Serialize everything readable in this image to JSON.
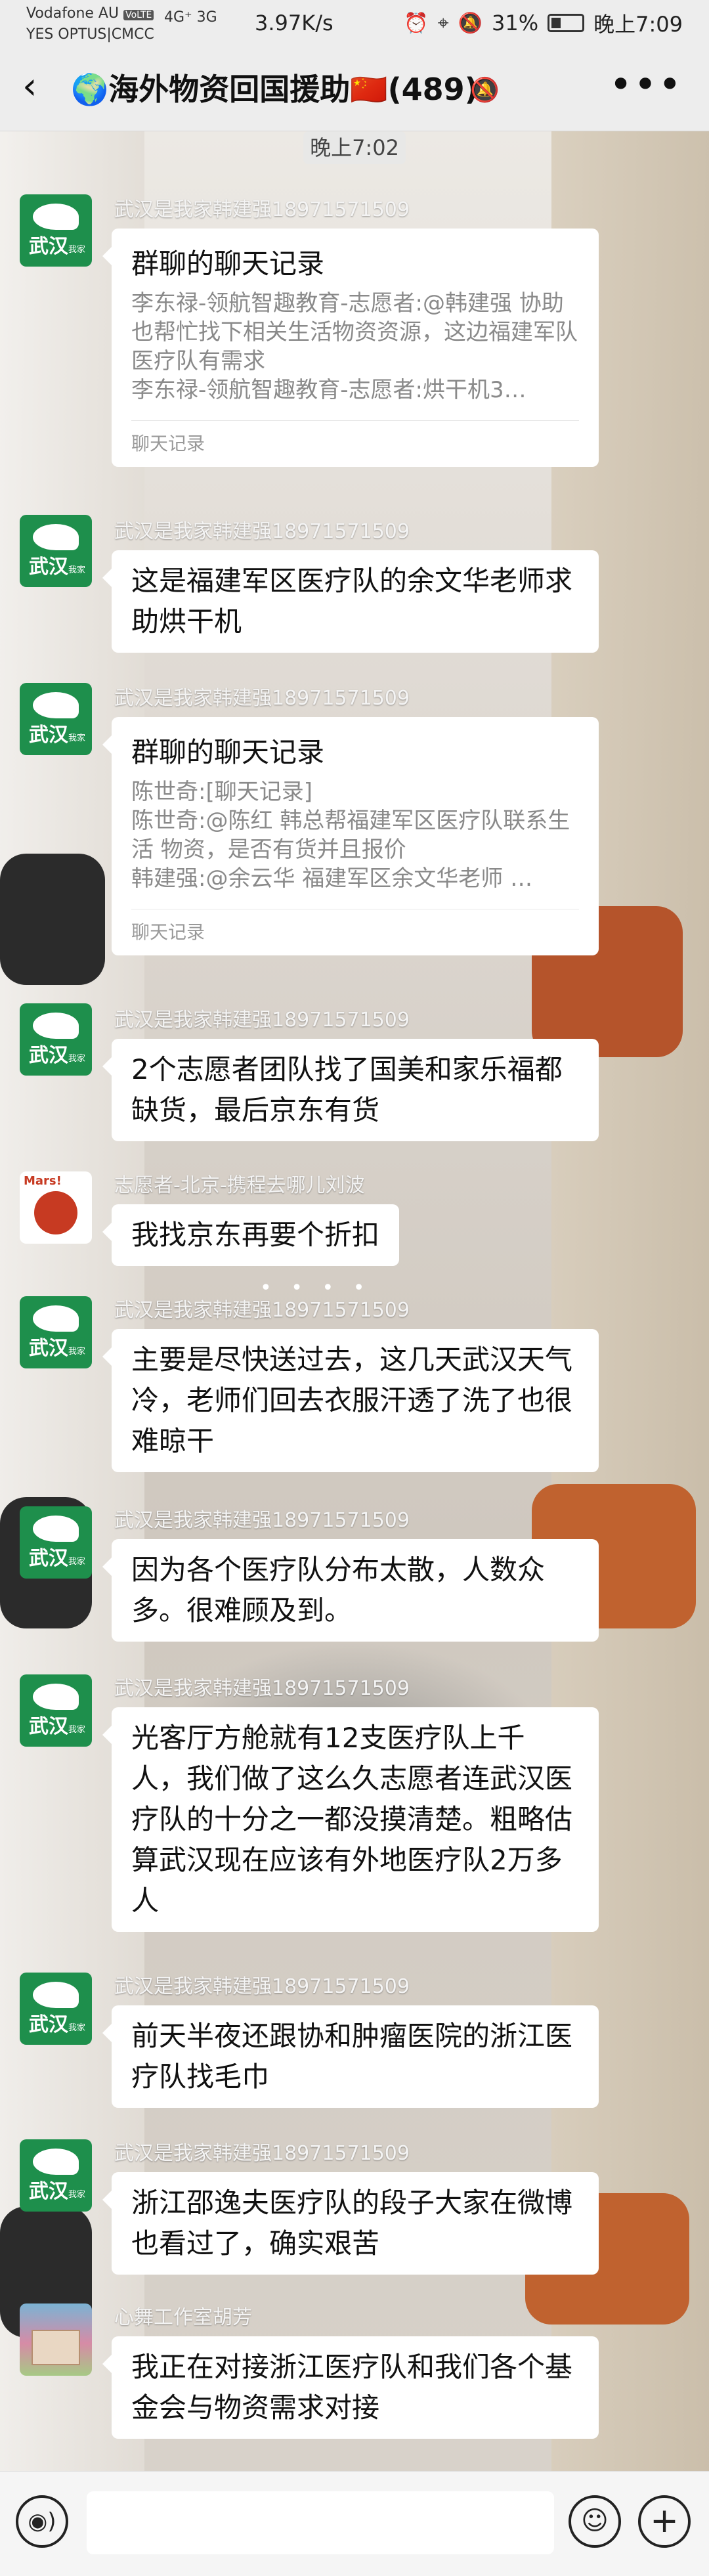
{
  "status_bar": {
    "carrier1": "Vodafone AU",
    "carrier1_badge": "VoLTE",
    "carrier2": "YES OPTUS|CMCC",
    "signal": "4G⁺ 3G",
    "speed": "3.97K/s",
    "battery": "31%",
    "time": "晚上7:09",
    "icons": [
      "alarm-icon",
      "location-icon",
      "mute-icon",
      "battery-icon"
    ]
  },
  "header": {
    "back_icon": "back-arrow-icon",
    "title": "🌍海外物资回国援助🇨🇳",
    "count": "(489)",
    "mute_icon": "bell-off-icon",
    "more_icon": "more-icon"
  },
  "time_divider": "晚上7:02",
  "messages": [
    {
      "sender": "武汉是我家韩建强18971571509",
      "type": "card",
      "card": {
        "title": "群聊的聊天记录",
        "lines": [
          "李东禄-领航智趣教育-志愿者:@韩建强 协助也帮忙找下相关生活物资资源，这边福建军队医疗队有需求",
          "李东禄-领航智趣教育-志愿者:烘干机3…"
        ],
        "footer": "聊天记录"
      }
    },
    {
      "sender": "武汉是我家韩建强18971571509",
      "type": "text",
      "text": "这是福建军区医疗队的余文华老师求助烘干机"
    },
    {
      "sender": "武汉是我家韩建强18971571509",
      "type": "card",
      "card": {
        "title": "群聊的聊天记录",
        "lines": [
          "陈世奇:[聊天记录]",
          "陈世奇:@陈红 韩总帮福建军区医疗队联系生活 物资，是否有货并且报价",
          "韩建强:@余云华 福建军区余文华老师 …"
        ],
        "footer": "聊天记录"
      }
    },
    {
      "sender": "武汉是我家韩建强18971571509",
      "type": "text",
      "text": "2个志愿者团队找了国美和家乐福都缺货，最后京东有货"
    },
    {
      "sender": "志愿者-北京-携程去哪儿刘波",
      "type": "text",
      "text": "我找京东再要个折扣"
    },
    {
      "sender": "武汉是我家韩建强18971571509",
      "type": "text",
      "text": "主要是尽快送过去，这几天武汉天气冷，老师们回去衣服汗透了洗了也很难晾干"
    },
    {
      "sender": "武汉是我家韩建强18971571509",
      "type": "text",
      "text": "因为各个医疗队分布太散，人数众多。很难顾及到。"
    },
    {
      "sender": "武汉是我家韩建强18971571509",
      "type": "text",
      "text": "光客厅方舱就有12支医疗队上千人，我们做了这么久志愿者连武汉医疗队的十分之一都没摸清楚。粗略估算武汉现在应该有外地医疗队2万多人"
    },
    {
      "sender": "武汉是我家韩建强18971571509",
      "type": "text",
      "text": "前天半夜还跟协和肿瘤医院的浙江医疗队找毛巾"
    },
    {
      "sender": "武汉是我家韩建强18971571509",
      "type": "text",
      "text": "浙江邵逸夫医疗队的段子大家在微博也看过了，确实艰苦"
    },
    {
      "sender": "心舞工作室胡芳",
      "type": "text",
      "text": "我正在对接浙江医疗队和我们各个基金会与物资需求对接"
    }
  ],
  "avatar_text": {
    "green_sign": "武汉",
    "green_sub": "我家",
    "mars": "Mars!"
  },
  "input_bar": {
    "voice_icon": "voice-icon",
    "emoji_icon": "emoji-icon",
    "plus_icon": "plus-icon",
    "placeholder": ""
  }
}
